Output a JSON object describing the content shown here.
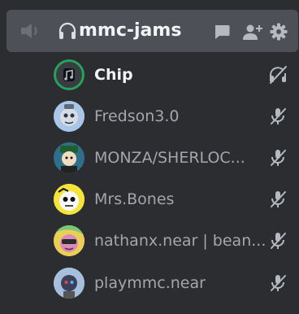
{
  "channel": {
    "name": "mmc-jams",
    "icons": {
      "left": "speaker-muted-icon",
      "prefix": "headphones-icon",
      "actions": [
        "chat-icon",
        "add-member-icon",
        "settings-icon"
      ]
    }
  },
  "users": [
    {
      "name": "Chip",
      "active": true,
      "avatar": "music-note-avatar",
      "status": "deafened-icon"
    },
    {
      "name": "Fredson3.0",
      "active": false,
      "avatar": "avatar",
      "status": "mic-muted-icon"
    },
    {
      "name": "MONZA/SHERLOC...",
      "active": false,
      "avatar": "avatar",
      "status": "mic-muted-icon"
    },
    {
      "name": "Mrs.Bones",
      "active": false,
      "avatar": "avatar",
      "status": "mic-muted-icon"
    },
    {
      "name": "nathanx.near | bean...",
      "active": false,
      "avatar": "avatar",
      "status": "mic-muted-icon"
    },
    {
      "name": "playmmc.near",
      "active": false,
      "avatar": "avatar",
      "status": "mic-muted-icon"
    }
  ],
  "colors": {
    "background": "#2b2d31",
    "header_bg": "#4e5058",
    "speaking_ring": "#23a55a",
    "active_text": "#f2f3f5",
    "muted_text": "#a3a6aa",
    "icon_gray": "#b5bac1"
  }
}
